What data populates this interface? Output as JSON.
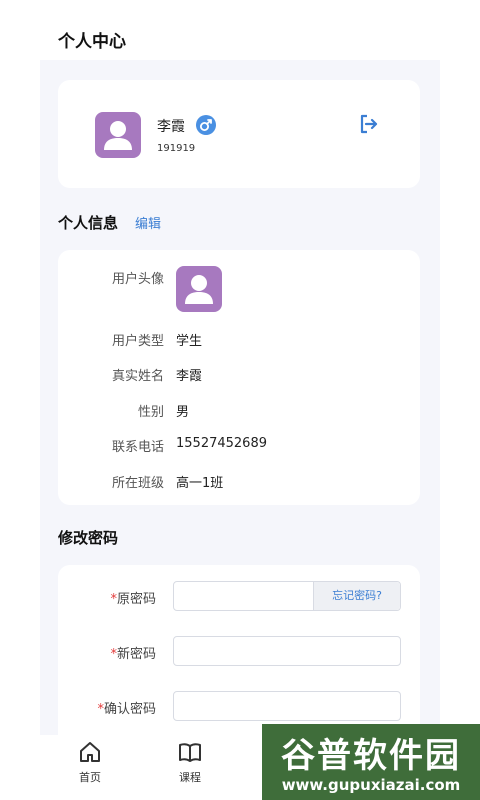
{
  "page": {
    "title": "个人中心"
  },
  "profile": {
    "name": "李霞",
    "id": "191919",
    "gender_icon": "male-icon",
    "avatar_color": "#a779bf",
    "logout_icon": "logout-icon"
  },
  "info": {
    "title": "个人信息",
    "edit_label": "编辑",
    "rows": [
      {
        "label": "用户头像",
        "value": ""
      },
      {
        "label": "用户类型",
        "value": "学生"
      },
      {
        "label": "真实姓名",
        "value": "李霞"
      },
      {
        "label": "性别",
        "value": "男"
      },
      {
        "label": "联系电话",
        "value": "15527452689"
      },
      {
        "label": "所在班级",
        "value": "高一1班"
      }
    ]
  },
  "password": {
    "title": "修改密码",
    "required_mark": "*",
    "fields": [
      {
        "label": "原密码",
        "value": "",
        "placeholder": ""
      },
      {
        "label": "新密码",
        "value": "",
        "placeholder": ""
      },
      {
        "label": "确认密码",
        "value": "",
        "placeholder": ""
      }
    ],
    "forgot_label": "忘记密码?"
  },
  "nav": {
    "items": [
      {
        "label": "首页",
        "icon": "home-icon"
      },
      {
        "label": "课程",
        "icon": "book-icon"
      }
    ]
  },
  "watermark": {
    "main": "谷普软件园",
    "sub": "www.gupuxiazai.com"
  },
  "colors": {
    "accent": "#3b7ed3",
    "required": "#e23b3b",
    "gender": "#4a90e2",
    "background": "#f5f6fb"
  }
}
